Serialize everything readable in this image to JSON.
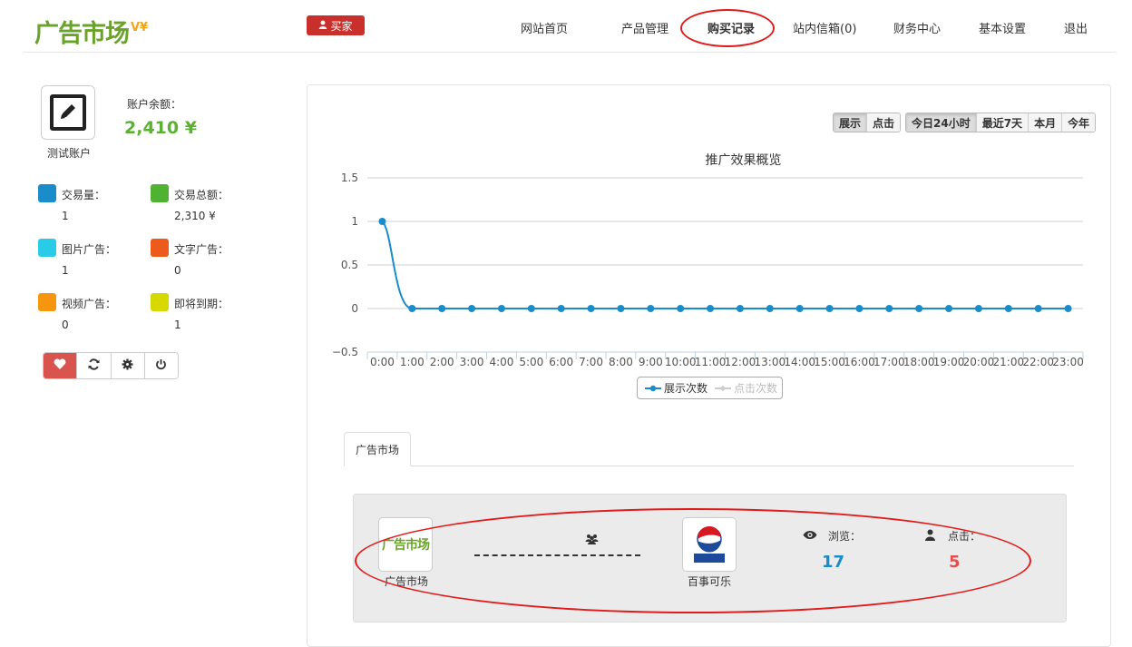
{
  "header": {
    "logo_text": "广告市场",
    "logo_sup": "V¥",
    "role_label": "买家",
    "nav": [
      {
        "label": "网站首页"
      },
      {
        "label": "产品管理"
      },
      {
        "label": "购买记录",
        "active": true
      },
      {
        "label": "站内信箱(0)"
      },
      {
        "label": "财务中心"
      },
      {
        "label": "基本设置"
      },
      {
        "label": "退出"
      }
    ]
  },
  "account": {
    "name": "测试账户",
    "balance_label": "账户余额：",
    "balance_value": "2,410 ¥",
    "stats": [
      {
        "label": "交易量：",
        "value": "1",
        "color": "#1a8cc9"
      },
      {
        "label": "交易总额：",
        "value": "2,310 ¥",
        "color": "#4fb233"
      },
      {
        "label": "图片广告：",
        "value": "1",
        "color": "#29cbe6"
      },
      {
        "label": "文字广告：",
        "value": "0",
        "color": "#ec5a1c"
      },
      {
        "label": "视频广告：",
        "value": "0",
        "color": "#f6960f"
      },
      {
        "label": "即将到期：",
        "value": "1",
        "color": "#d7d800"
      }
    ],
    "toolbar_icons": [
      "heart-icon",
      "refresh-icon",
      "gear-icon",
      "power-icon"
    ]
  },
  "filters": {
    "metric": [
      {
        "label": "展示",
        "active": true
      },
      {
        "label": "点击"
      }
    ],
    "range": [
      {
        "label": "今日24小时",
        "active": true
      },
      {
        "label": "最近7天"
      },
      {
        "label": "本月"
      },
      {
        "label": "今年"
      }
    ]
  },
  "chart_data": {
    "type": "line",
    "title": "推广效果概览",
    "x": [
      "0:00",
      "1:00",
      "2:00",
      "3:00",
      "4:00",
      "5:00",
      "6:00",
      "7:00",
      "8:00",
      "9:00",
      "10:00",
      "11:00",
      "12:00",
      "13:00",
      "14:00",
      "15:00",
      "16:00",
      "17:00",
      "18:00",
      "19:00",
      "20:00",
      "21:00",
      "22:00",
      "23:00"
    ],
    "series": [
      {
        "name": "展示次数",
        "values": [
          1,
          0,
          0,
          0,
          0,
          0,
          0,
          0,
          0,
          0,
          0,
          0,
          0,
          0,
          0,
          0,
          0,
          0,
          0,
          0,
          0,
          0,
          0,
          0
        ],
        "color": "#1a8cc9",
        "visible": true
      },
      {
        "name": "点击次数",
        "values": [],
        "color": "#cccccc",
        "visible": false
      }
    ],
    "y_ticks": [
      "1.5",
      "1",
      "0.5",
      "0",
      "-0.5"
    ],
    "ylim": [
      -0.5,
      1.5
    ],
    "grid": true,
    "legend": "bottom"
  },
  "tabs": [
    {
      "label": "广告市场",
      "active": true
    }
  ],
  "deal": {
    "seller_name": "广告市场",
    "buyer_name": "百事可乐",
    "buyer_logo_text": "百事可乐",
    "views_label": "浏览：",
    "views_value": "17",
    "clicks_label": "点击：",
    "clicks_value": "5"
  }
}
